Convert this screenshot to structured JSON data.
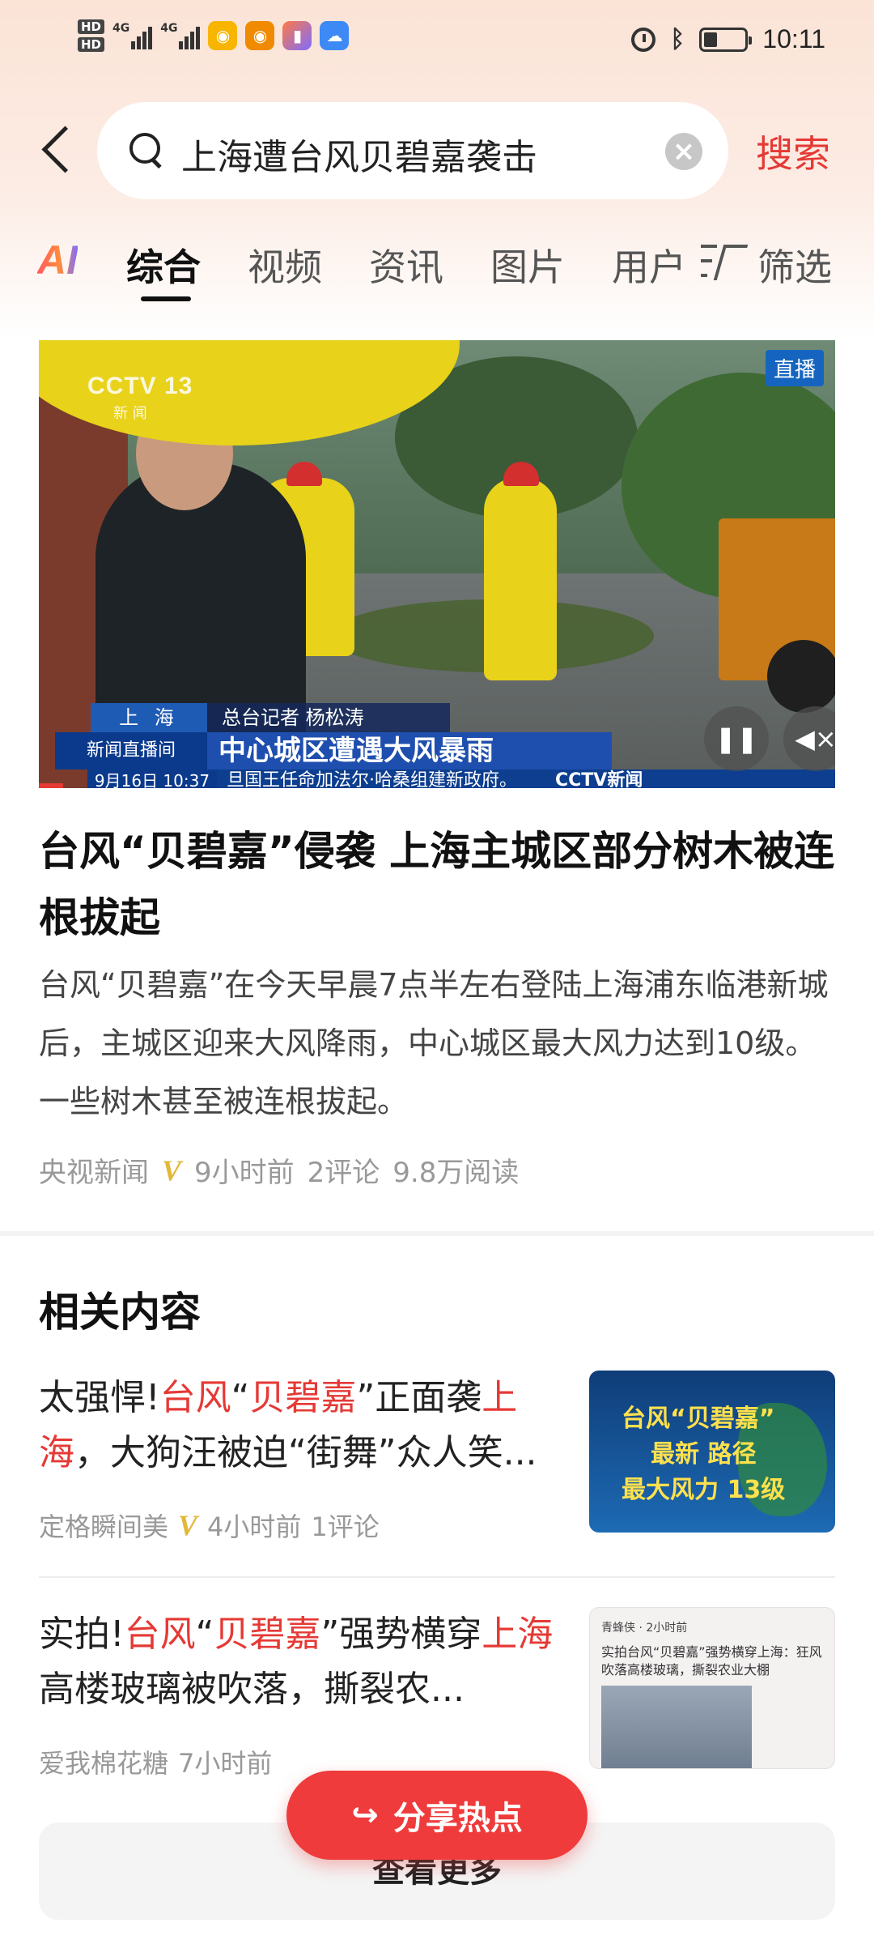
{
  "status_bar": {
    "hd1": "HD",
    "hd2": "HD",
    "sig1": "4G",
    "sig2": "4G",
    "time": "10:11"
  },
  "search": {
    "query": "上海遭台风贝碧嘉袭击",
    "button_label": "搜索"
  },
  "tabs": {
    "ai_label": "AI",
    "items": [
      "综合",
      "视频",
      "资讯",
      "图片",
      "用户"
    ],
    "active_index": 0,
    "filter_label": "筛选"
  },
  "video": {
    "logo": "CCTV 13",
    "logo_sub": "新 闻",
    "live_badge": "直播",
    "location": "上 海",
    "reporter": "总台记者 杨松涛",
    "program": "新闻直播间",
    "headline": "中心城区遭遇大风暴雨",
    "date": "9月16日 10:37",
    "ticker": "旦国王任命加法尔·哈桑组建新政府。",
    "ticker_logo": "CCTV新闻"
  },
  "article": {
    "title": "台风“贝碧嘉”侵袭 上海主城区部分树木被连根拔起",
    "summary": "台风“贝碧嘉”在今天早晨7点半左右登陆上海浦东临港新城后，主城区迎来大风降雨，中心城区最大风力达到10级。一些树木甚至被连根拔起。",
    "source": "央视新闻",
    "verified_mark": "V",
    "time_ago": "9小时前",
    "comments": "2评论",
    "reads": "9.8万阅读"
  },
  "related": {
    "section_title": "相关内容",
    "items": [
      {
        "title_parts": [
          "太强悍!",
          "台风",
          "“",
          "贝碧嘉",
          "”正面袭",
          "上海",
          "，大狗汪被迫“街舞”众人笑..."
        ],
        "source": "定格瞬间美",
        "verified_mark": "V",
        "time_ago": "4小时前",
        "comments": "1评论",
        "thumb_line1": "台风“贝碧嘉”",
        "thumb_line2": "最新 路径",
        "thumb_line3": "最大风力 13级"
      },
      {
        "title_parts": [
          "实拍!",
          "台风",
          "“",
          "贝碧嘉",
          "”强势横穿",
          "上海",
          " 高楼玻璃被吹落，撕裂农..."
        ],
        "source": "爱我棉花糖",
        "time_ago": "7小时前",
        "thumb_account": "青蜂侠 · 2小时前",
        "thumb_caption": "实拍台风“贝碧嘉”强势横穿上海：狂风吹落高楼玻璃，撕裂农业大棚"
      }
    ]
  },
  "share_button": "分享热点",
  "more_button": "查看更多",
  "colors": {
    "accent": "#e53935",
    "highlight": "#e53935",
    "verified": "#e2b83a"
  }
}
